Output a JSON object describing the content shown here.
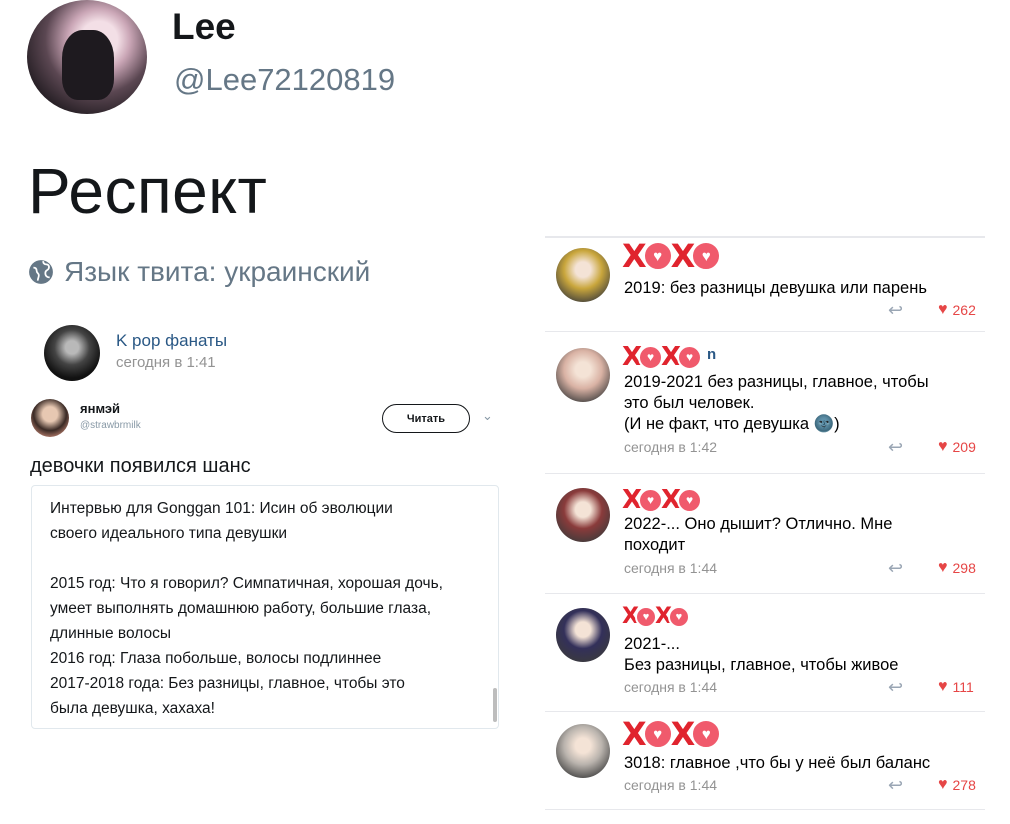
{
  "tweet": {
    "display_name": "Lee",
    "handle": "@Lee72120819",
    "text": "Респект",
    "language_note": "Язык твита: украинский"
  },
  "left_post": {
    "group_name": "K pop фанаты",
    "group_time": "сегодня в 1:41",
    "embedded_tweet": {
      "name": "янмэй",
      "handle": "@strawbrmilk",
      "follow_label": "Читать",
      "text": "девочки появился шанс",
      "quote_lines": [
        "Интервью для Gonggan 101: Исин об эволюции",
        "своего идеального типа девушки",
        "",
        "2015 год: Что я говорил? Симпатичная, хорошая дочь,",
        "умеет выполнять домашнюю работу, большие глаза,",
        "длинные волосы",
        "2016 год: Глаза побольше, волосы подлиннее",
        "2017-2018 года: Без разницы, главное, чтобы это",
        "была девушка, хахаха!"
      ]
    }
  },
  "comments": [
    {
      "marks": "XOXO",
      "name": "",
      "lines": [
        "2019: без разницы девушка или парень"
      ],
      "time": "",
      "likes": "262",
      "avatar_color": "#c9a63c"
    },
    {
      "marks": "XOXO",
      "name": "n",
      "lines": [
        "2019-2021 без разницы, главное, чтобы",
        "это был человек.",
        "(И не факт, что девушка 🌚)"
      ],
      "time": "сегодня в 1:42",
      "likes": "209",
      "avatar_color": "#d9b2a4"
    },
    {
      "marks": "XOXO",
      "name": "",
      "lines": [
        "2022-... Оно дышит? Отлично. Мне",
        "походит"
      ],
      "time": "сегодня в 1:44",
      "likes": "298",
      "avatar_color": "#8a3b3b"
    },
    {
      "marks": "XOXO",
      "name": "",
      "lines": [
        "2021-...",
        "Без разницы, главное, чтобы живое"
      ],
      "time": "сегодня в 1:44",
      "likes": "111",
      "avatar_color": "#33305a"
    },
    {
      "marks": "XOXO",
      "name": "",
      "lines": [
        "3018: главное ,что бы у неё был баланс"
      ],
      "time": "сегодня в 1:44",
      "likes": "278",
      "avatar_color": "#b9b3ad"
    }
  ],
  "colors": {
    "link_blue": "#2a5885",
    "muted_gray": "#939393",
    "like_red": "#e64646",
    "x_red": "#e0242e",
    "twitter_gray": "#657786"
  },
  "icons": [
    "globe-icon",
    "chevron-down-icon",
    "reply-icon",
    "heart-icon"
  ]
}
